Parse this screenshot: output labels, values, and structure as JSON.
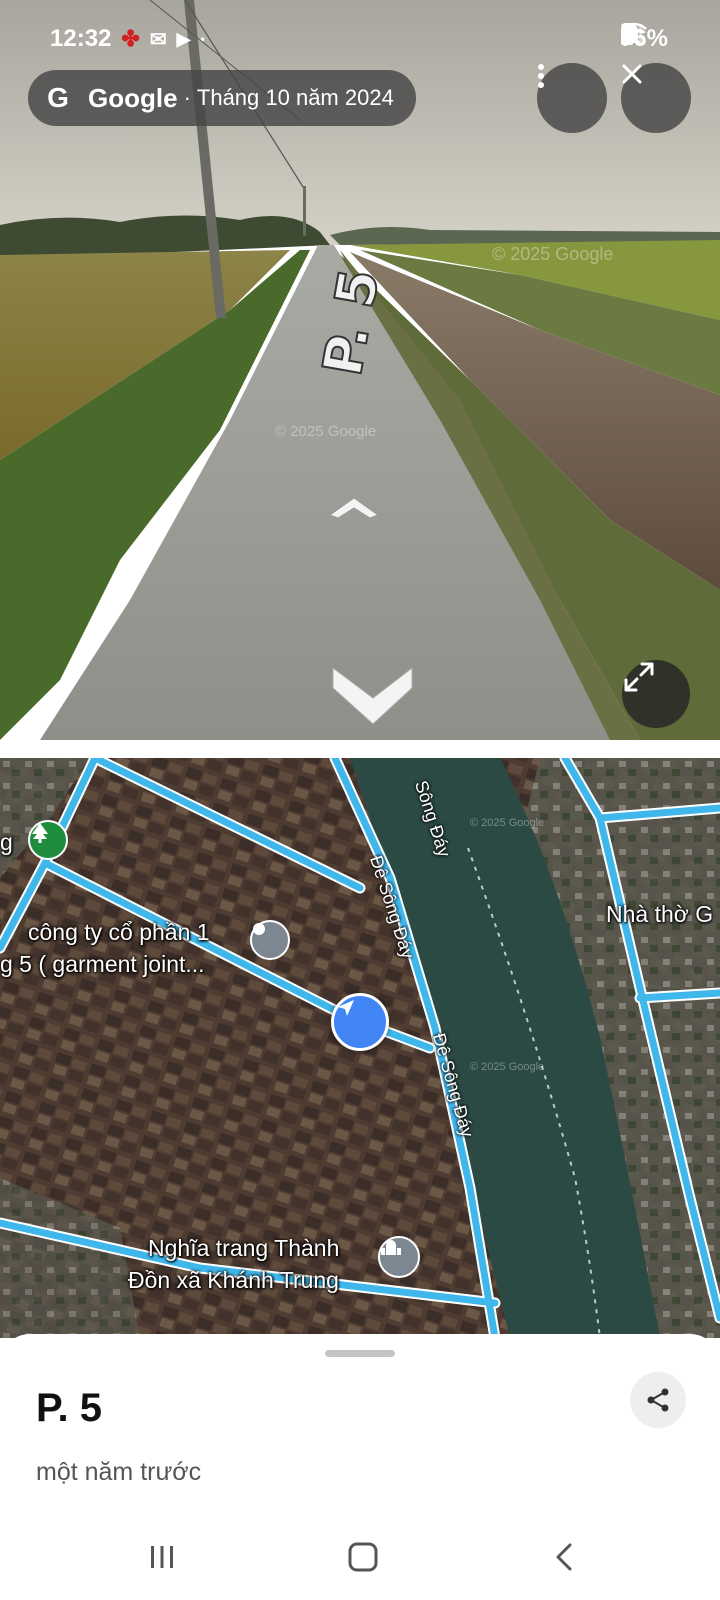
{
  "status_bar": {
    "time": "12:32",
    "battery": "76%",
    "icons": [
      "notification-app-icon",
      "mail-icon",
      "media-icon",
      "mute-icon",
      "location-icon",
      "wifi-icon",
      "signal-icon",
      "battery-icon"
    ]
  },
  "street_view": {
    "provider": "Google",
    "separator": "·",
    "date": "Tháng 10 năm 2024",
    "road_marking": "P. 5",
    "watermark": "© 2025 Google",
    "icons": {
      "logo": "google-g-icon",
      "more": "more-vertical-icon",
      "close": "close-icon",
      "forward": "chevron-up-icon",
      "back": "chevron-down-icon",
      "expand": "expand-icon"
    }
  },
  "map": {
    "labels": {
      "company_line1": "công ty cổ phần 1",
      "company_line2": "g 5 ( garment joint...",
      "church": "Nhà thờ G",
      "cemetery_line1": "Nghĩa trang Thành",
      "cemetery_line2": "Đồn xã Khánh Trung",
      "left_edge": "g",
      "river": "Sông Đáy",
      "dike_1": "Đê Sông Đáy",
      "dike_2": "Đê Sông Đáy"
    },
    "colors": {
      "road": "#3fb7ea",
      "road_outline": "#ffffff",
      "river": "#2c4a44",
      "pin_blue": "#4285f4",
      "park_green": "#1e8e3e"
    },
    "icons": {
      "park": "tree-icon",
      "place": "location-pin-icon",
      "cemetery": "cemetery-icon",
      "position": "navigation-arrow-icon"
    }
  },
  "bottom_sheet": {
    "title": "P. 5",
    "subtitle": "một năm trước",
    "share_icon": "share-icon"
  },
  "nav_bar": {
    "icons": [
      "recent-apps-icon",
      "home-icon",
      "back-icon"
    ]
  }
}
